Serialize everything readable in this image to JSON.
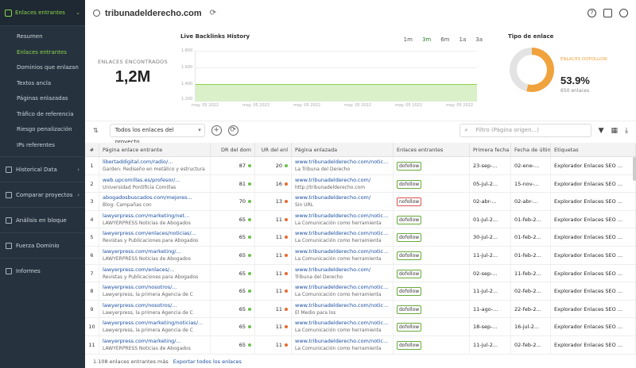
{
  "sidebar": {
    "section_label": "Enlaces entrantes",
    "sub_items": [
      {
        "label": "Resumen",
        "active": false
      },
      {
        "label": "Enlaces entrantes",
        "active": true
      },
      {
        "label": "Dominios que enlazan",
        "active": false
      },
      {
        "label": "Textos ancla",
        "active": false
      },
      {
        "label": "Páginas enlazadas",
        "active": false
      },
      {
        "label": "Tráfico de referencia",
        "active": false
      },
      {
        "label": "Riesgo penalización",
        "active": false
      },
      {
        "label": "IPs referentes",
        "active": false
      }
    ],
    "groups": [
      {
        "label": "Historical Data"
      },
      {
        "label": "Comparar proyectos"
      },
      {
        "label": "Análisis en bloque"
      },
      {
        "label": "Fuerza Dominio"
      },
      {
        "label": "Informes"
      }
    ]
  },
  "header": {
    "domain": "tribunadelderecho.com"
  },
  "stats": {
    "found_label": "ENLACES ENCONTRADOS",
    "found_value": "1,2M",
    "history_title": "Live Backlinks History",
    "ranges": [
      "1m",
      "3m",
      "6m",
      "1a",
      "3a"
    ],
    "active_range": "3m",
    "y_ticks": [
      "1.800",
      "1.600",
      "1.400",
      "1.200"
    ],
    "x_ticks": [
      "may. 05 2022",
      "may. 05 2022",
      "may. 05 2022",
      "may. 05 2022",
      "may. 05 2022",
      "may. 05 2022"
    ],
    "type_title": "Tipo de enlace",
    "type_legend": "ENLACES DOFOLLOW",
    "type_pct": "53.9%",
    "type_sub": "650 enlaces",
    "dofollow_fraction": 0.539
  },
  "toolbar": {
    "filter_value": "Todos los enlaces del proyecto",
    "search_placeholder": "Filtro (Página origen...)"
  },
  "table": {
    "headers": [
      "#",
      "Página enlace entrante",
      "DR del dom",
      "UR del enl",
      "Página enlazada",
      "Enlaces entrantes",
      "Primera fecha",
      "Fecha de última",
      "Etiquetas"
    ],
    "rows": [
      {
        "n": "1",
        "src": "libertaddigital.com/radio/...",
        "src_sub": "Garden: Rediseño en metálico y estructura",
        "dr": "87",
        "ur": "20",
        "link": "www.tribunadelderecho.com/noticias",
        "link_sub": "La Tribuna del Derecho",
        "type": "dofollow",
        "first": "23-sep-...",
        "last": "02-ene-...",
        "tag": "Explorador Enlaces SEO ..."
      },
      {
        "n": "2",
        "src": "web.upcomillas.es/profesor/...",
        "src_sub": "Universidad Pontificia Comillas",
        "dr": "81",
        "ur": "16",
        "link": "www.tribunadelderecho.com/",
        "link_sub": "http://tribunadelderecho.com",
        "type": "dofollow",
        "first": "05-jul-2...",
        "last": "15-nov-...",
        "tag": "Explorador Enlaces SEO ..."
      },
      {
        "n": "3",
        "src": "abogadosbuscados.com/mejores...",
        "src_sub": "Blog: Campañas con",
        "dr": "70",
        "ur": "13",
        "link": "www.tribunadelderecho.com/",
        "link_sub": "Sin URL",
        "type": "nofollow",
        "first": "02-abr-...",
        "last": "02-abr-...",
        "tag": "Explorador Enlaces SEO ..."
      },
      {
        "n": "4",
        "src": "lawyerpress.com/marketing/net...",
        "src_sub": "LAWYERPRESS Noticias de Abogados",
        "dr": "65",
        "ur": "11",
        "link": "www.tribunadelderecho.com/noticias",
        "link_sub": "La Comunicación como herramienta",
        "type": "dofollow",
        "first": "01-jul-2...",
        "last": "01-feb-2...",
        "tag": "Explorador Enlaces SEO ..."
      },
      {
        "n": "5",
        "src": "lawyerpress.com/enlaces/noticias/...",
        "src_sub": "Revistas y Publicaciones para Abogados",
        "dr": "65",
        "ur": "11",
        "link": "www.tribunadelderecho.com/noticias",
        "link_sub": "La Comunicación como herramienta",
        "type": "dofollow",
        "first": "30-jul-2...",
        "last": "01-feb-2...",
        "tag": "Explorador Enlaces SEO ..."
      },
      {
        "n": "6",
        "src": "lawyerpress.com/marketing/...",
        "src_sub": "LAWYERPRESS Noticias de Abogados",
        "dr": "65",
        "ur": "11",
        "link": "www.tribunadelderecho.com/noticias",
        "link_sub": "La Comunicación como herramienta",
        "type": "dofollow",
        "first": "11-jul-2...",
        "last": "01-feb-2...",
        "tag": "Explorador Enlaces SEO ..."
      },
      {
        "n": "7",
        "src": "lawyerpress.com/enlaces/...",
        "src_sub": "Revistas y Publicaciones para Abogados",
        "dr": "65",
        "ur": "11",
        "link": "www.tribunadelderecho.com/",
        "link_sub": "Tribuna del Derecho",
        "type": "dofollow",
        "first": "02-sep-...",
        "last": "11-feb-2...",
        "tag": "Explorador Enlaces SEO ..."
      },
      {
        "n": "8",
        "src": "lawyerpress.com/nosotros/...",
        "src_sub": "Lawyerpress, la primera Agencia de C",
        "dr": "65",
        "ur": "11",
        "link": "www.tribunadelderecho.com/noticias",
        "link_sub": "La Comunicación como herramienta",
        "type": "dofollow",
        "first": "11-jul-2...",
        "last": "02-feb-2...",
        "tag": "Explorador Enlaces SEO ..."
      },
      {
        "n": "9",
        "src": "lawyerpress.com/nosotros/...",
        "src_sub": "Lawyerpress, la primera Agencia de C",
        "dr": "65",
        "ur": "11",
        "link": "www.tribunadelderecho.com/noticias",
        "link_sub": "El Medio para los",
        "type": "dofollow",
        "first": "11-ago-...",
        "last": "22-feb-2...",
        "tag": "Explorador Enlaces SEO ..."
      },
      {
        "n": "10",
        "src": "lawyerpress.com/marketing/noticias/...",
        "src_sub": "Lawyerpress, la primera Agencia de C",
        "dr": "65",
        "ur": "11",
        "link": "www.tribunadelderecho.com/noticias",
        "link_sub": "La Comunicación como herramienta",
        "type": "dofollow",
        "first": "18-sep-...",
        "last": "16-jul-2...",
        "tag": "Explorador Enlaces SEO ..."
      },
      {
        "n": "11",
        "src": "lawyerpress.com/marketing/...",
        "src_sub": "LAWYERPRESS Noticias de Abogados",
        "dr": "65",
        "ur": "11",
        "link": "www.tribunadelderecho.com/noticias",
        "link_sub": "La Comunicación como herramienta",
        "type": "dofollow",
        "first": "11-jul-2...",
        "last": "02-feb-2...",
        "tag": "Explorador Enlaces SEO ..."
      }
    ]
  },
  "footer": {
    "count_text": "1.108 enlaces entrantes más",
    "export_link": "Exportar todos los enlaces"
  },
  "colors": {
    "accent": "#8bd34a",
    "sidebar_bg": "#26333f",
    "donut": "#f0a23c",
    "link": "#1a4fa0"
  }
}
